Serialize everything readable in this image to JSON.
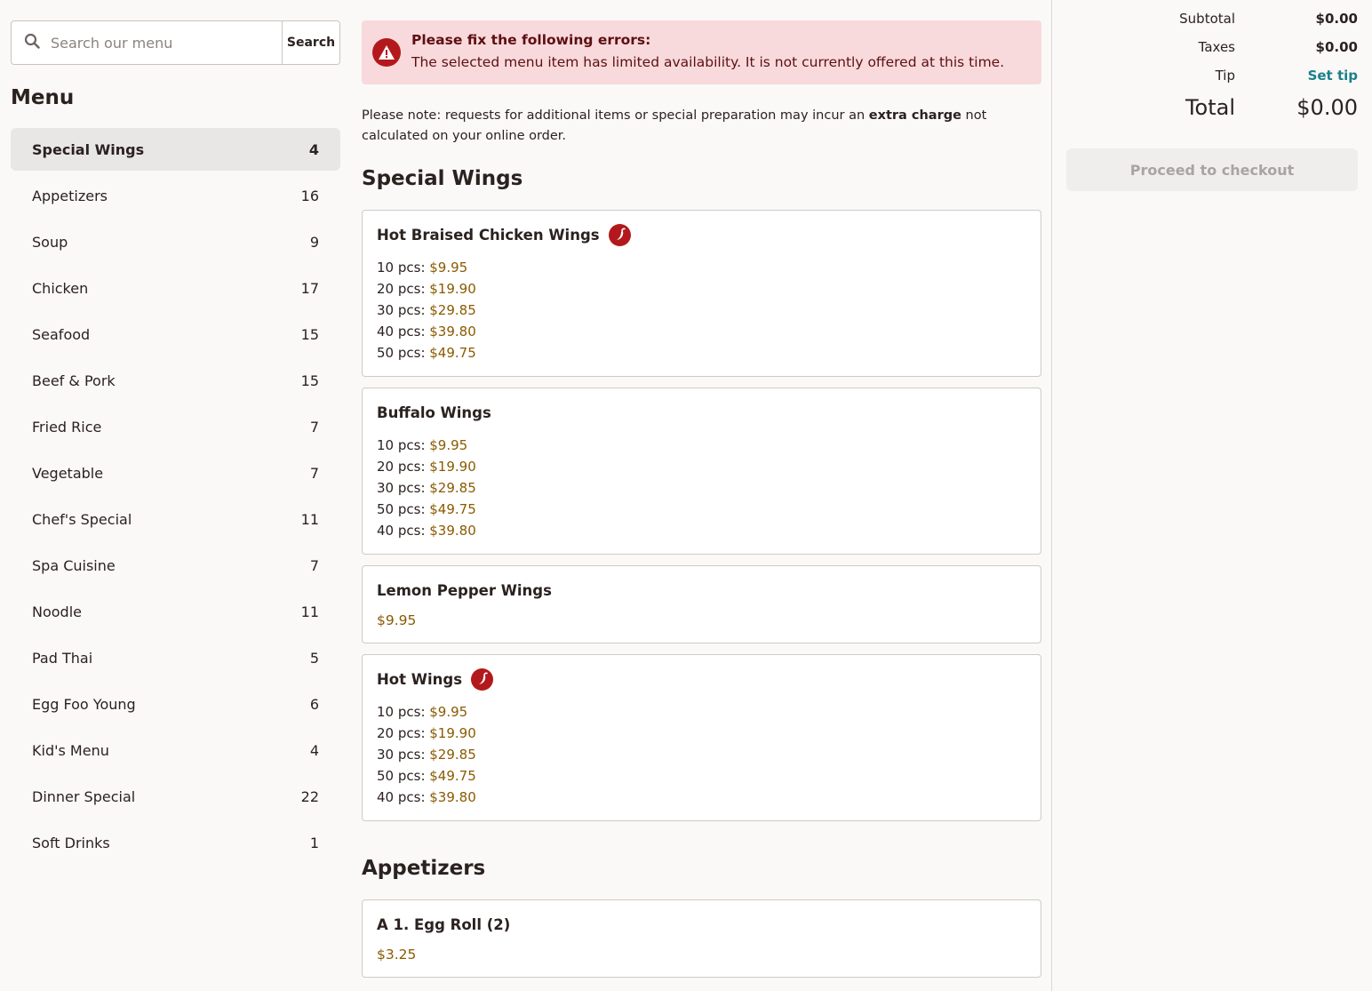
{
  "search": {
    "placeholder": "Search our menu",
    "button_label": "Search"
  },
  "menu": {
    "heading": "Menu",
    "categories": [
      {
        "label": "Special Wings",
        "count": "4",
        "active": true
      },
      {
        "label": "Appetizers",
        "count": "16"
      },
      {
        "label": "Soup",
        "count": "9"
      },
      {
        "label": "Chicken",
        "count": "17"
      },
      {
        "label": "Seafood",
        "count": "15"
      },
      {
        "label": "Beef & Pork",
        "count": "15"
      },
      {
        "label": "Fried Rice",
        "count": "7"
      },
      {
        "label": "Vegetable",
        "count": "7"
      },
      {
        "label": "Chef's Special",
        "count": "11"
      },
      {
        "label": "Spa Cuisine",
        "count": "7"
      },
      {
        "label": "Noodle",
        "count": "11"
      },
      {
        "label": "Pad Thai",
        "count": "5"
      },
      {
        "label": "Egg Foo Young",
        "count": "6"
      },
      {
        "label": "Kid's Menu",
        "count": "4"
      },
      {
        "label": "Dinner Special",
        "count": "22"
      },
      {
        "label": "Soft Drinks",
        "count": "1"
      }
    ]
  },
  "alert": {
    "title": "Please fix the following errors:",
    "message": "The selected menu item has limited availability. It is not currently offered at this time.",
    "icon": "warning-icon",
    "color": "#b3191c"
  },
  "note": {
    "prefix": "Please note: requests for additional items or special preparation may incur an ",
    "emphasis": "extra charge",
    "suffix": " not calculated on your online order."
  },
  "sections": [
    {
      "title": "Special Wings",
      "items": [
        {
          "name": "Hot Braised Chicken Wings",
          "spicy": true,
          "prices": [
            {
              "label": "10 pcs: ",
              "value": "$9.95"
            },
            {
              "label": "20 pcs: ",
              "value": "$19.90"
            },
            {
              "label": "30 pcs: ",
              "value": "$29.85"
            },
            {
              "label": "40 pcs: ",
              "value": "$39.80"
            },
            {
              "label": "50 pcs: ",
              "value": "$49.75"
            }
          ]
        },
        {
          "name": "Buffalo Wings",
          "spicy": false,
          "prices": [
            {
              "label": "10 pcs: ",
              "value": "$9.95"
            },
            {
              "label": "20 pcs: ",
              "value": "$19.90"
            },
            {
              "label": "30 pcs: ",
              "value": "$29.85"
            },
            {
              "label": "50 pcs: ",
              "value": "$49.75"
            },
            {
              "label": "40 pcs: ",
              "value": "$39.80"
            }
          ]
        },
        {
          "name": "Lemon Pepper Wings",
          "spicy": false,
          "price": "$9.95"
        },
        {
          "name": "Hot Wings",
          "spicy": true,
          "prices": [
            {
              "label": "10 pcs: ",
              "value": "$9.95"
            },
            {
              "label": "20 pcs: ",
              "value": "$19.90"
            },
            {
              "label": "30 pcs: ",
              "value": "$29.85"
            },
            {
              "label": "50 pcs: ",
              "value": "$49.75"
            },
            {
              "label": "40 pcs: ",
              "value": "$39.80"
            }
          ]
        }
      ]
    },
    {
      "title": "Appetizers",
      "items": [
        {
          "name": "A 1. Egg Roll (2)",
          "spicy": false,
          "price": "$3.25"
        }
      ]
    }
  ],
  "cart": {
    "subtotal_label": "Subtotal",
    "subtotal_value": "$0.00",
    "taxes_label": "Taxes",
    "taxes_value": "$0.00",
    "tip_label": "Tip",
    "tip_action": "Set tip",
    "total_label": "Total",
    "total_value": "$0.00",
    "checkout_label": "Proceed to checkout"
  },
  "colors": {
    "price": "#8a5a00",
    "link": "#1b7f8a",
    "spicy_icon": "#b3191c",
    "alert_bg": "#f9dadc"
  }
}
